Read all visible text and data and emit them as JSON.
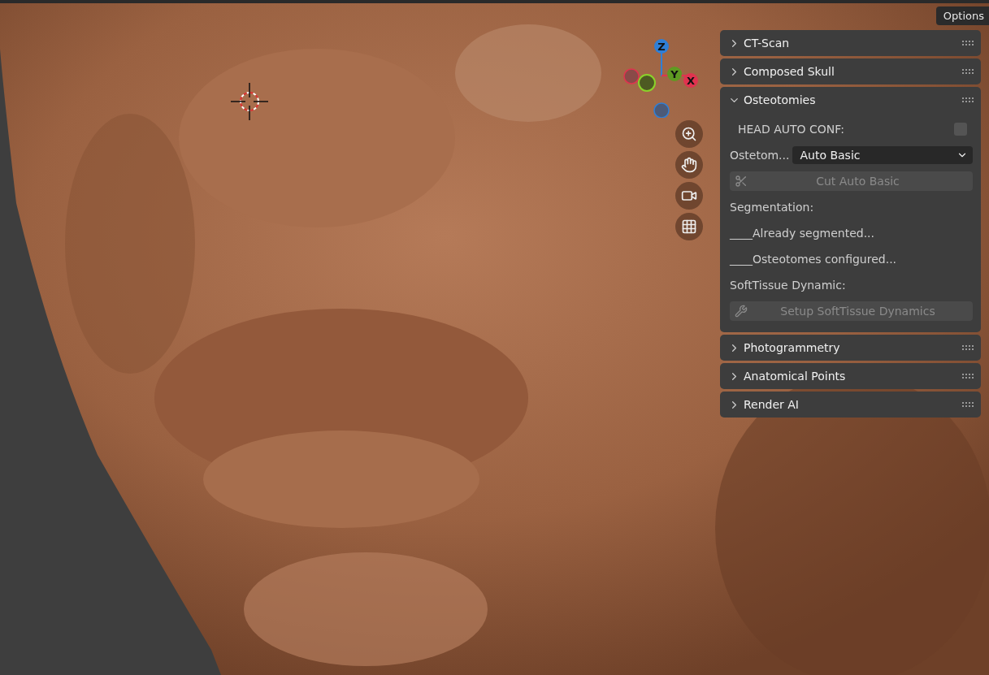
{
  "options_button": "Options",
  "gizmo": {
    "axes": [
      {
        "label": "Z",
        "color": "#2f7fd6"
      },
      {
        "label": "Y",
        "color": "#5f9a22"
      },
      {
        "label": "X",
        "color": "#e0334f"
      }
    ]
  },
  "panels": [
    {
      "title": "CT-Scan",
      "expanded": false
    },
    {
      "title": "Composed Skull",
      "expanded": false
    },
    {
      "title": "Osteotomies",
      "expanded": true,
      "rows": [
        {
          "kind": "checkbox",
          "label": "HEAD AUTO CONF:",
          "checked": false
        },
        {
          "kind": "dropdown",
          "label": "Ostetom...",
          "value": "Auto Basic"
        },
        {
          "kind": "button",
          "label": "Cut Auto Basic",
          "disabled": true
        },
        {
          "kind": "text",
          "label": "Segmentation:"
        },
        {
          "kind": "text",
          "label": "____Already segmented..."
        },
        {
          "kind": "text",
          "label": "____Osteotomes configured..."
        },
        {
          "kind": "text",
          "label": "SoftTissue Dynamic:"
        },
        {
          "kind": "button",
          "label": "Setup SoftTissue Dynamics",
          "disabled": true
        }
      ]
    },
    {
      "title": "Photogrammetry",
      "expanded": false
    },
    {
      "title": "Anatomical Points",
      "expanded": false
    },
    {
      "title": "Render AI",
      "expanded": false
    }
  ]
}
